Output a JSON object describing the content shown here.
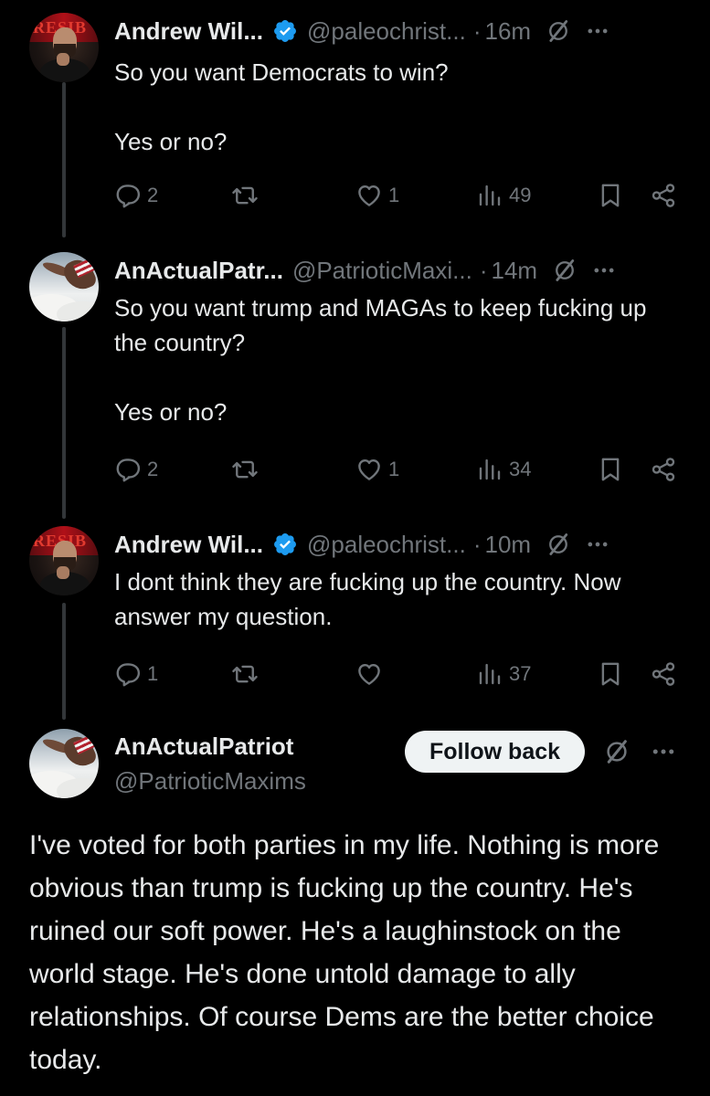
{
  "colors": {
    "background": "#000000",
    "text": "#e7e9ea",
    "muted": "#71767b",
    "verified": "#1d9bf0",
    "button_bg": "#eff3f4",
    "button_text": "#0f1419",
    "thread_line": "#333639"
  },
  "tweets": [
    {
      "display_name": "Andrew Wil...",
      "verified": true,
      "handle": "@paleochrist...",
      "dot": "·",
      "time": "16m",
      "text": "So you want Democrats to win?\n\nYes or no?",
      "replies": "2",
      "retweets": "",
      "likes": "1",
      "views": "49"
    },
    {
      "display_name": "AnActualPatr...",
      "verified": false,
      "handle": "@PatrioticMaxi...",
      "dot": "·",
      "time": "14m",
      "text": "So you want trump and MAGAs to keep fucking up the country?\n\nYes or no?",
      "replies": "2",
      "retweets": "",
      "likes": "1",
      "views": "34"
    },
    {
      "display_name": "Andrew Wil...",
      "verified": true,
      "handle": "@paleochrist...",
      "dot": "·",
      "time": "10m",
      "text": "I dont think they are fucking up the country. Now answer my question.",
      "replies": "1",
      "retweets": "",
      "likes": "",
      "views": "37"
    }
  ],
  "main_tweet": {
    "display_name": "AnActualPatriot",
    "handle": "@PatrioticMaxims",
    "follow_label": "Follow back",
    "text": "I've voted for both parties in my life. Nothing is more obvious than trump is fucking up the country. He's ruined our soft power. He's a laughinstock on the world stage. He's done untold damage to ally relationships. Of course Dems are the better choice today."
  },
  "avatar_banner_text": "RESIB",
  "icons": {
    "verified": "verified-badge-icon",
    "grok": "grok-icon",
    "more": "more-icon",
    "reply": "reply-icon",
    "retweet": "retweet-icon",
    "like": "like-icon",
    "views": "views-icon",
    "bookmark": "bookmark-icon",
    "share": "share-icon"
  }
}
